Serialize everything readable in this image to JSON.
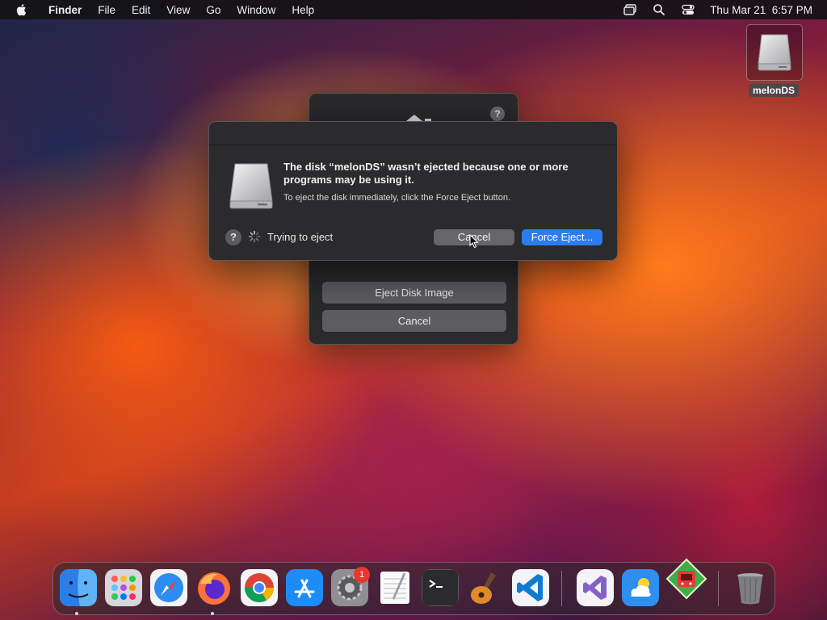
{
  "menubar": {
    "app_name": "Finder",
    "menus": [
      "File",
      "Edit",
      "View",
      "Go",
      "Window",
      "Help"
    ],
    "clock": "Thu Mar 21  6:57 PM",
    "status_icons": [
      "screen-mirroring-icon",
      "spotlight-search-icon",
      "control-center-icon"
    ]
  },
  "desktop": {
    "disk_label": "melonDS"
  },
  "back_panel": {
    "buttons": [
      "Eject Disk Image",
      "Cancel"
    ],
    "help": "?"
  },
  "alert": {
    "title": "The disk “melonDS” wasn’t ejected because one or more programs may be using it.",
    "message": "To eject the disk immediately, click the Force Eject button.",
    "help": "?",
    "status": "Trying to eject",
    "cancel_label": "Cancel",
    "force_label": "Force Eject..."
  },
  "dock": {
    "apps": [
      "Finder",
      "Launchpad",
      "Safari",
      "Firefox",
      "Chrome",
      "App Store",
      "System Settings",
      "TextEdit",
      "Terminal",
      "GarageBand",
      "Visual Studio Code",
      "Visual Studio",
      "Weather",
      "melonDS",
      "Trash"
    ],
    "settings_badge": "1"
  },
  "colors": {
    "accent": "#2a7df0",
    "alert_bg": "#2b2b2d"
  }
}
